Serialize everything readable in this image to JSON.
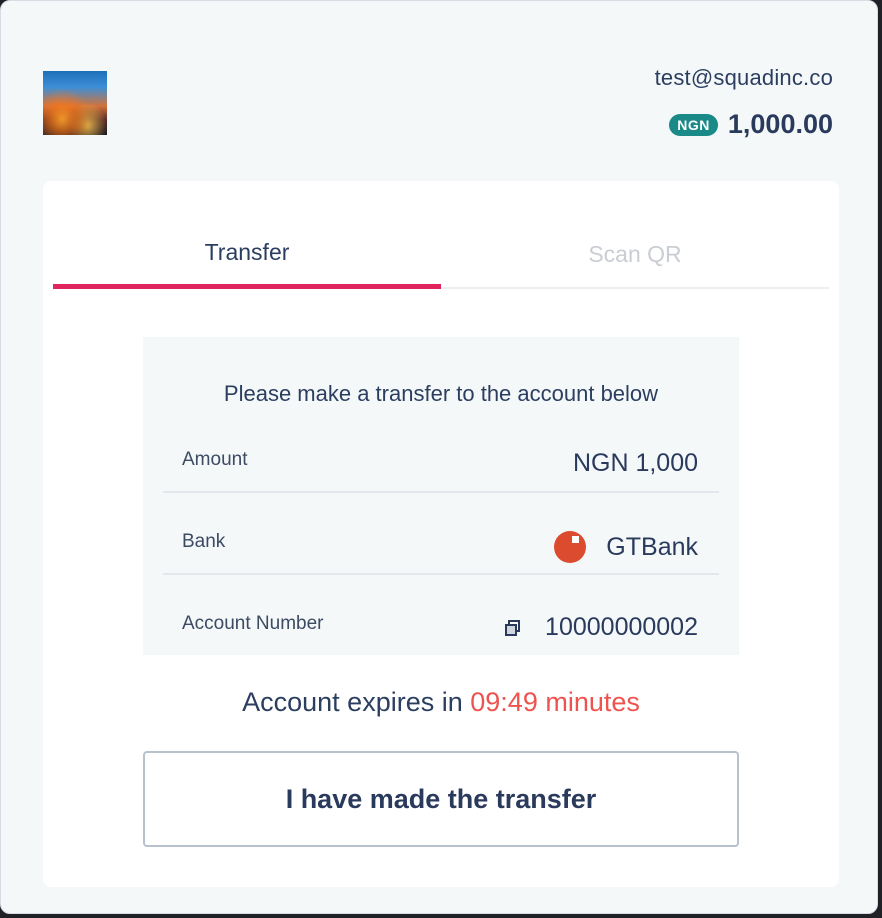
{
  "header": {
    "logo_icon": "merchant-logo-image",
    "email": "test@squadinc.co",
    "currency_badge": "NGN",
    "total_amount": "1,000.00"
  },
  "tabs": [
    {
      "label": "Transfer",
      "active": true
    },
    {
      "label": "Scan QR",
      "active": false
    }
  ],
  "transfer": {
    "instruction": "Please make a transfer to the account below",
    "rows": [
      {
        "label": "Amount",
        "value": "NGN 1,000"
      },
      {
        "label": "Bank",
        "value": "GTBank",
        "icon": "gtbank-logo-icon"
      },
      {
        "label": "Account Number",
        "value": "10000000002",
        "icon": "copy-icon"
      }
    ],
    "expires_prefix": "Account expires in",
    "expires_time": "09:49 minutes",
    "confirm_label": "I have made the transfer"
  },
  "colors": {
    "accent": "#e0245e",
    "badge": "#1a8a88",
    "timer": "#ef5350",
    "text": "#2a3a5c",
    "bank": "#dd4b2e"
  }
}
